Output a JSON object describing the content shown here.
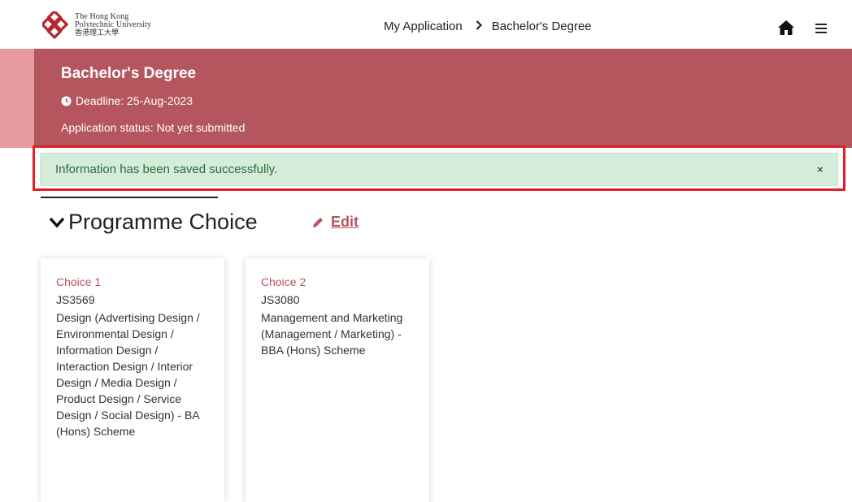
{
  "header": {
    "logo": {
      "line1": "The Hong Kong",
      "line2": "Polytechnic University",
      "line3": "香港理工大學"
    },
    "breadcrumb": [
      "My Application",
      "Bachelor's Degree"
    ],
    "icons": {
      "home": "home-icon",
      "menu": "hamburger-menu-icon",
      "separator": "chevron-right-icon"
    }
  },
  "banner": {
    "title": "Bachelor's Degree",
    "deadline": "Deadline: 25-Aug-2023",
    "status": "Application status: Not yet submitted",
    "color": "#b5555d"
  },
  "alert": {
    "message": "Information has been saved successfully.",
    "close": "×"
  },
  "section": {
    "title": "Programme Choice",
    "edit_label": "Edit"
  },
  "choices": [
    {
      "label": "Choice 1",
      "code": "JS3569",
      "name": "Design (Advertising Design / Environmental Design / Information Design / Interaction Design / Interior Design / Media Design / Product Design / Service Design / Social Design) - BA (Hons) Scheme"
    },
    {
      "label": "Choice 2",
      "code": "JS3080",
      "name": "Management and Marketing (Management / Marketing) - BBA (Hons) Scheme"
    }
  ]
}
